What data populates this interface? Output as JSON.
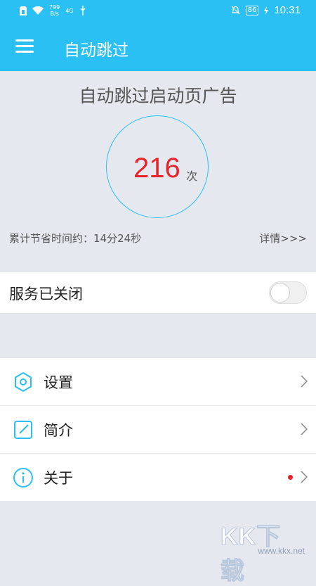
{
  "status_bar": {
    "net_speed": "799\nB/s",
    "signal_small": "4G",
    "battery": "86",
    "time": "10:31"
  },
  "app_bar": {
    "title": "自动跳过"
  },
  "summary": {
    "headline": "自动跳过启动页广告",
    "count": "216",
    "count_unit": "次",
    "saved_time": "累计节省时间约：14分24秒",
    "details": "详情>>>"
  },
  "service": {
    "label": "服务已关闭",
    "enabled": false
  },
  "menu": [
    {
      "label": "设置",
      "icon": "hexagon-settings-icon"
    },
    {
      "label": "简介",
      "icon": "edit-icon"
    },
    {
      "label": "关于",
      "icon": "info-icon",
      "badge": "red-dot"
    }
  ],
  "watermark": {
    "text": "KK下载",
    "url": "www.kkx.net"
  },
  "colors": {
    "accent": "#2ac0f4",
    "count": "#e8232a",
    "background": "#e6e8ef"
  }
}
